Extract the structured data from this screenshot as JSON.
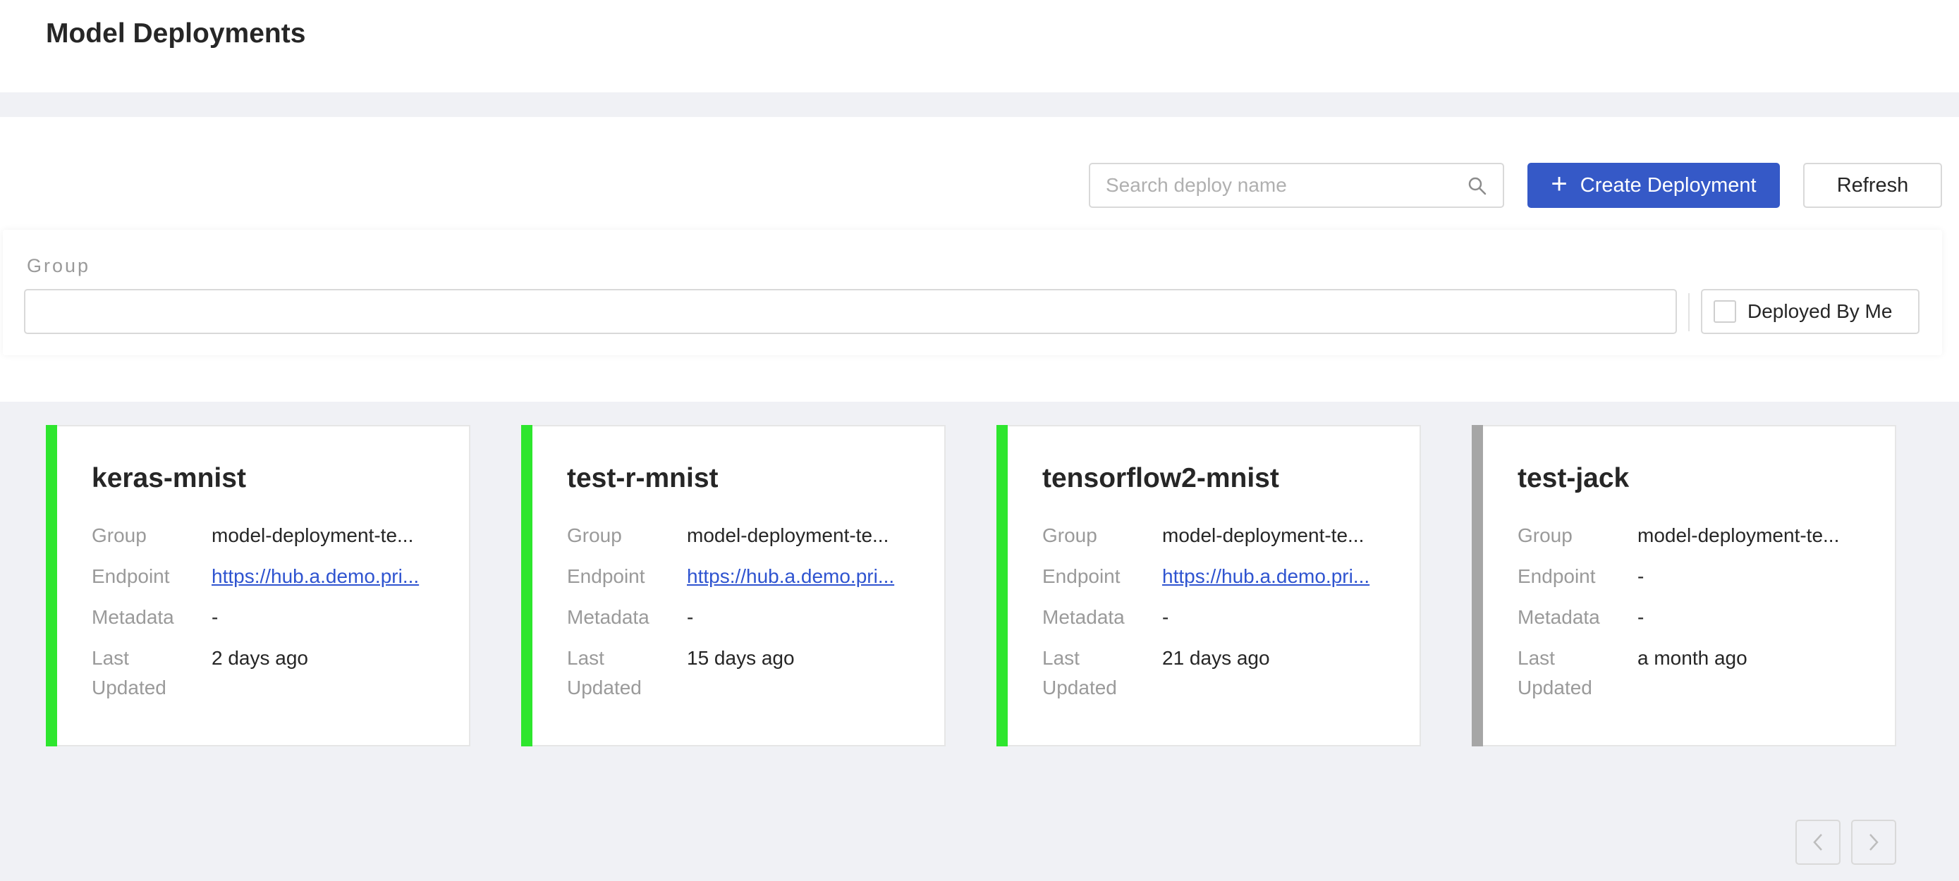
{
  "header": {
    "title": "Model Deployments"
  },
  "toolbar": {
    "search_placeholder": "Search deploy name",
    "search_value": "",
    "create_label": "Create Deployment",
    "refresh_label": "Refresh"
  },
  "filters": {
    "group_label": "Group",
    "group_value": "",
    "deployed_by_me_label": "Deployed By Me",
    "deployed_by_me_checked": false
  },
  "field_labels": {
    "group": "Group",
    "endpoint": "Endpoint",
    "metadata": "Metadata",
    "last": "Last",
    "updated": "Updated"
  },
  "cards": [
    {
      "name": "keras-mnist",
      "group": "model-deployment-te...",
      "endpoint": "https://hub.a.demo.pri...",
      "metadata": "-",
      "last_updated": "2 days ago",
      "status_color": "#2ee62e"
    },
    {
      "name": "test-r-mnist",
      "group": "model-deployment-te...",
      "endpoint": "https://hub.a.demo.pri...",
      "metadata": "-",
      "last_updated": "15 days ago",
      "status_color": "#2ee62e"
    },
    {
      "name": "tensorflow2-mnist",
      "group": "model-deployment-te...",
      "endpoint": "https://hub.a.demo.pri...",
      "metadata": "-",
      "last_updated": "21 days ago",
      "status_color": "#2ee62e"
    },
    {
      "name": "test-jack",
      "group": "model-deployment-te...",
      "endpoint": "-",
      "metadata": "-",
      "last_updated": "a month ago",
      "status_color": "#a6a6a6"
    }
  ],
  "pagination": {
    "prev_icon": "chevron-left-icon",
    "next_icon": "chevron-right-icon"
  },
  "colors": {
    "primary": "#3559c7",
    "active": "#2ee62e",
    "inactive": "#a6a6a6"
  }
}
